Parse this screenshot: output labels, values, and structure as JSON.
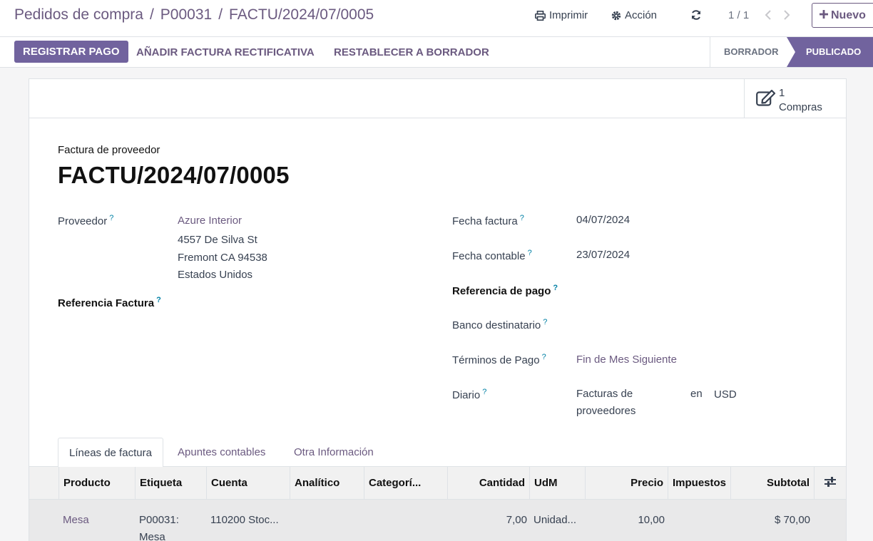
{
  "breadcrumb": {
    "items": [
      "Pedidos de compra",
      "P00031"
    ],
    "current": "FACTU/2024/07/0005"
  },
  "toolbar": {
    "print_label": "Imprimir",
    "action_label": "Acción",
    "pager": "1 / 1",
    "new_label": "Nuevo"
  },
  "statusbar": {
    "register_payment": "REGISTRAR PAGO",
    "add_credit_note": "AÑADIR FACTURA RECTIFICATIVA",
    "reset_to_draft": "RESTABLECER A BORRADOR",
    "stages": [
      {
        "label": "BORRADOR",
        "active": false
      },
      {
        "label": "PUBLICADO",
        "active": true
      }
    ]
  },
  "smart_button": {
    "count": "1",
    "label": "Compras"
  },
  "document": {
    "type_label": "Factura de proveedor",
    "name": "FACTU/2024/07/0005"
  },
  "fields": {
    "vendor_label": "Proveedor",
    "vendor_name": "Azure Interior",
    "vendor_address": [
      "4557 De Silva St",
      "Fremont CA 94538",
      "Estados Unidos"
    ],
    "invoice_ref_label": "Referencia Factura",
    "invoice_date_label": "Fecha factura",
    "invoice_date": "04/07/2024",
    "accounting_date_label": "Fecha contable",
    "accounting_date": "23/07/2024",
    "payment_ref_label": "Referencia de pago",
    "recipient_bank_label": "Banco destinatario",
    "payment_terms_label": "Términos de Pago",
    "payment_terms": "Fin de Mes Siguiente",
    "journal_label": "Diario",
    "journal_value": [
      "Facturas de",
      "proveedores"
    ],
    "journal_in": "en",
    "currency": "USD",
    "help_mark": "?"
  },
  "tabs": [
    "Líneas de factura",
    "Apuntes contables",
    "Otra Información"
  ],
  "table": {
    "headers": [
      "Producto",
      "Etiqueta",
      "Cuenta",
      "Analítico",
      "Categorí...",
      "Cantidad",
      "UdM",
      "Precio",
      "Impuestos",
      "Subtotal"
    ],
    "rows": [
      {
        "product": "Mesa",
        "label": [
          "P00031:",
          "Mesa"
        ],
        "account": "110200 Stoc...",
        "analytic": "",
        "category": "",
        "quantity": "7,00",
        "uom": "Unidad...",
        "price": "10,00",
        "taxes": "",
        "subtotal": "$ 70,00"
      }
    ]
  }
}
